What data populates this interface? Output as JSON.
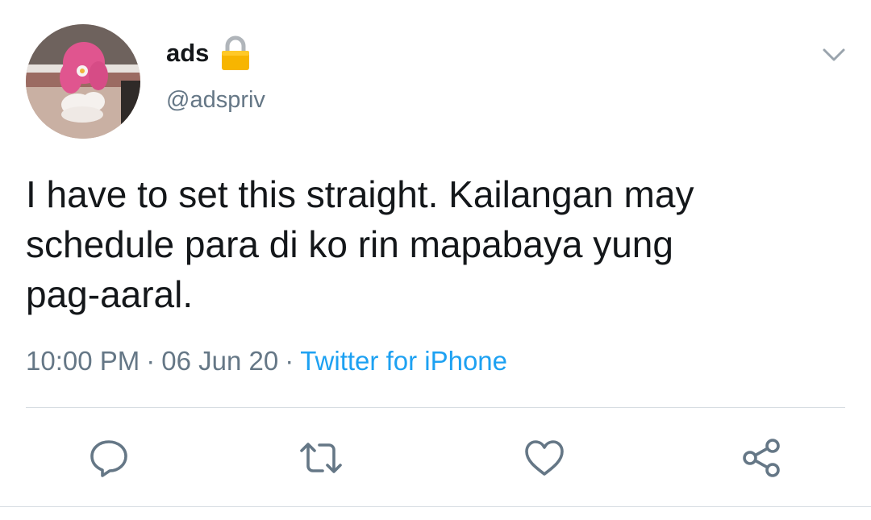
{
  "user": {
    "display_name": "ads",
    "handle": "@adspriv",
    "protected_icon": "lock-icon",
    "avatar": "avatar-image"
  },
  "tweet": {
    "text": "I have to set this straight. Kailangan may\nschedule para di ko rin mapabaya yung\npag-aaral.",
    "time": "10:00 PM",
    "date": "06 Jun 20",
    "separator": "·",
    "source": "Twitter for iPhone"
  },
  "actions": [
    {
      "name": "reply",
      "icon": "reply-icon"
    },
    {
      "name": "retweet",
      "icon": "retweet-icon"
    },
    {
      "name": "like",
      "icon": "heart-icon"
    },
    {
      "name": "share",
      "icon": "share-icon"
    }
  ],
  "menu_icon": "chevron-down-icon",
  "colors": {
    "text": "#14171a",
    "secondary": "#657786",
    "link": "#1da1f2",
    "icon": "#657786",
    "divider": "#d7dde2"
  }
}
